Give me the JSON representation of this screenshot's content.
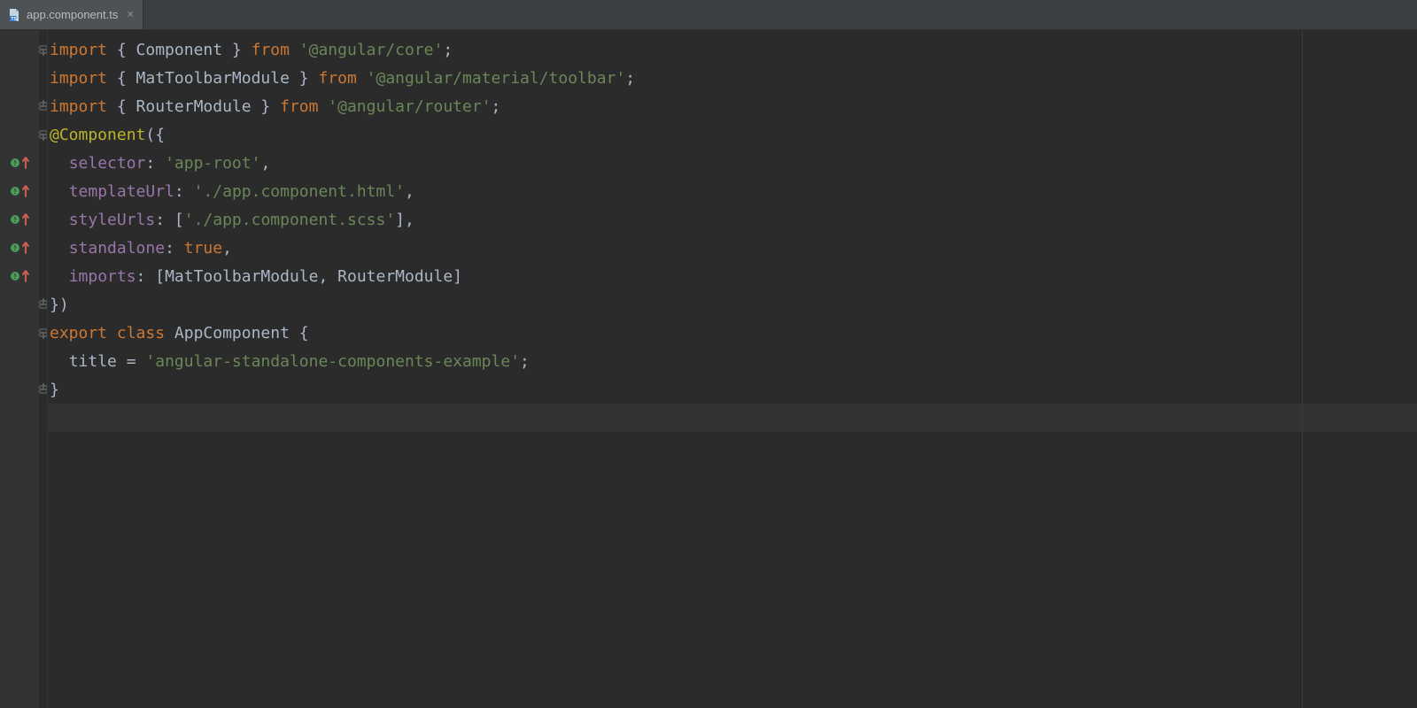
{
  "tab": {
    "filename": "app.component.ts",
    "close": "×"
  },
  "code": {
    "l1": {
      "kw1": "import",
      "brace1": " { ",
      "id": "Component",
      "brace2": " } ",
      "kw2": "from ",
      "str": "'@angular/core'",
      "end": ";"
    },
    "l2": {
      "kw1": "import",
      "brace1": " { ",
      "id": "MatToolbarModule",
      "brace2": " } ",
      "kw2": "from ",
      "str": "'@angular/material/toolbar'",
      "end": ";"
    },
    "l3": {
      "kw1": "import",
      "brace1": " { ",
      "id": "RouterModule",
      "brace2": " } ",
      "kw2": "from ",
      "str": "'@angular/router'",
      "end": ";"
    },
    "l4": {
      "deco": "@Component",
      "open": "({"
    },
    "l5": {
      "indent": "  ",
      "prop": "selector",
      "colon": ": ",
      "str": "'app-root'",
      "comma": ","
    },
    "l6": {
      "indent": "  ",
      "prop": "templateUrl",
      "colon": ": ",
      "str": "'./app.component.html'",
      "comma": ","
    },
    "l7": {
      "indent": "  ",
      "prop": "styleUrls",
      "colon": ": [",
      "str": "'./app.component.scss'",
      "comma": "],"
    },
    "l8": {
      "indent": "  ",
      "prop": "standalone",
      "colon": ": ",
      "kw": "true",
      "comma": ","
    },
    "l9": {
      "indent": "  ",
      "prop": "imports",
      "colon": ": [",
      "id1": "MatToolbarModule",
      "sep": ", ",
      "id2": "RouterModule",
      "close": "]"
    },
    "l10": {
      "txt": "})"
    },
    "l11": {
      "kw1": "export ",
      "kw2": "class ",
      "id": "AppComponent",
      "brace": " {"
    },
    "l12": {
      "indent": "  ",
      "id": "title",
      "eq": " = ",
      "str": "'angular-standalone-components-example'",
      "end": ";"
    },
    "l13": {
      "txt": "}"
    }
  }
}
